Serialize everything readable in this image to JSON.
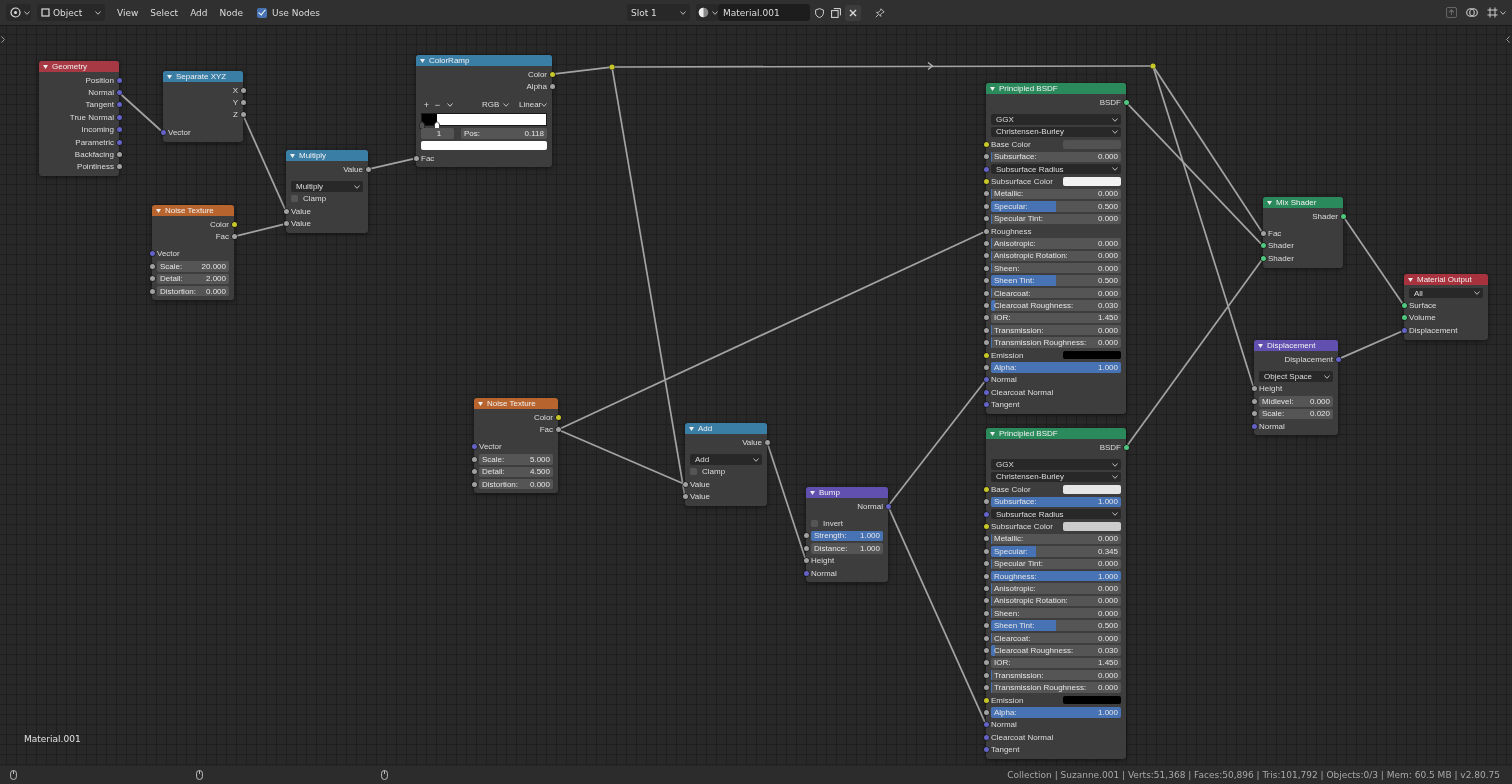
{
  "header": {
    "mode": "Object",
    "menus": [
      "View",
      "Select",
      "Add",
      "Node"
    ],
    "use_nodes": {
      "label": "Use Nodes",
      "checked": true
    },
    "slot": "Slot 1",
    "material": "Material.001"
  },
  "nodes": [
    {
      "title": "Geometry",
      "color": "#a63943",
      "rows": [
        {
          "kind": "output",
          "label": "Position",
          "socket": {
            "color": "#6363c7"
          }
        },
        {
          "kind": "output",
          "label": "Normal",
          "socket": {
            "color": "#6363c7"
          }
        },
        {
          "kind": "output",
          "label": "Tangent",
          "socket": {
            "color": "#6363c7"
          }
        },
        {
          "kind": "output",
          "label": "True Normal",
          "socket": {
            "color": "#6363c7"
          }
        },
        {
          "kind": "output",
          "label": "Incoming",
          "socket": {
            "color": "#6363c7"
          }
        },
        {
          "kind": "output",
          "label": "Parametric",
          "socket": {
            "color": "#6363c7"
          }
        },
        {
          "kind": "output",
          "label": "Backfacing",
          "socket": {
            "color": "#a1a1a1"
          }
        },
        {
          "kind": "output",
          "label": "Pointiness",
          "socket": {
            "color": "#a1a1a1"
          }
        }
      ]
    },
    {
      "title": "Separate XYZ",
      "color": "#3a7ea6",
      "rows": [
        {
          "kind": "output",
          "label": "X",
          "socket": {
            "color": "#a1a1a1"
          }
        },
        {
          "kind": "output",
          "label": "Y",
          "socket": {
            "color": "#a1a1a1"
          }
        },
        {
          "kind": "output",
          "label": "Z",
          "socket": {
            "color": "#a1a1a1"
          }
        },
        {
          "kind": "input",
          "label": "Vector",
          "socket": {
            "color": "#6363c7"
          }
        }
      ]
    },
    {
      "title": "Multiply",
      "color": "#3a7ea6",
      "rows": [
        {
          "kind": "output",
          "label": "Value",
          "socket": {
            "color": "#a1a1a1"
          }
        },
        {
          "kind": "dropdown",
          "value": "Multiply"
        },
        {
          "kind": "checkbox",
          "label": "Clamp",
          "checked": false
        },
        {
          "kind": "input",
          "label": "Value",
          "socket": {
            "color": "#a1a1a1"
          }
        },
        {
          "kind": "input",
          "label": "Value",
          "socket": {
            "color": "#a1a1a1"
          }
        }
      ]
    },
    {
      "title": "Noise Texture",
      "color": "#b8642e",
      "rows": [
        {
          "kind": "output",
          "label": "Color",
          "socket": {
            "color": "#c7c729"
          }
        },
        {
          "kind": "output",
          "label": "Fac",
          "socket": {
            "color": "#a1a1a1"
          }
        },
        {
          "kind": "input",
          "label": "Vector",
          "socket": {
            "color": "#6363c7"
          }
        },
        {
          "kind": "number",
          "label": "Scale:",
          "value": "20.000",
          "socket": {
            "color": "#a1a1a1"
          }
        },
        {
          "kind": "number",
          "label": "Detail:",
          "value": "2.000",
          "socket": {
            "color": "#a1a1a1"
          }
        },
        {
          "kind": "number",
          "label": "Distortion:",
          "value": "0.000",
          "socket": {
            "color": "#a1a1a1"
          }
        }
      ]
    },
    {
      "title": "ColorRamp",
      "color": "#3a7ea6",
      "rows": [
        {
          "kind": "output",
          "label": "Color",
          "socket": {
            "color": "#c7c729"
          }
        },
        {
          "kind": "output",
          "label": "Alpha",
          "socket": {
            "color": "#a1a1a1"
          }
        },
        {
          "kind": "ramp-tools",
          "add": "+",
          "remove": "−",
          "color_mode": "RGB",
          "interpolation": "Linear"
        },
        {
          "kind": "ramp-bar",
          "stops": [
            {
              "color": "#000000",
              "level": 0,
              "selected": false
            },
            {
              "color": "#ffffff",
              "level": 0.118,
              "selected": true
            }
          ]
        },
        {
          "kind": "ramp-stop",
          "index": "1",
          "label": "Pos:",
          "value": "0.118"
        },
        {
          "kind": "color-field",
          "color": "#ffffff"
        },
        {
          "kind": "input",
          "label": "Fac",
          "socket": {
            "color": "#a1a1a1"
          }
        }
      ]
    },
    {
      "title": "Noise Texture",
      "color": "#b8642e",
      "rows": [
        {
          "kind": "output",
          "label": "Color",
          "socket": {
            "color": "#c7c729"
          }
        },
        {
          "kind": "output",
          "label": "Fac",
          "socket": {
            "color": "#a1a1a1"
          }
        },
        {
          "kind": "input",
          "label": "Vector",
          "socket": {
            "color": "#6363c7"
          }
        },
        {
          "kind": "number",
          "label": "Scale:",
          "value": "5.000",
          "socket": {
            "color": "#a1a1a1"
          }
        },
        {
          "kind": "number",
          "label": "Detail:",
          "value": "4.500",
          "socket": {
            "color": "#a1a1a1"
          }
        },
        {
          "kind": "number",
          "label": "Distortion:",
          "value": "0.000",
          "socket": {
            "color": "#a1a1a1"
          }
        }
      ]
    },
    {
      "title": "Add",
      "color": "#3a7ea6",
      "rows": [
        {
          "kind": "output",
          "label": "Value",
          "socket": {
            "color": "#a1a1a1"
          }
        },
        {
          "kind": "dropdown",
          "value": "Add"
        },
        {
          "kind": "checkbox",
          "label": "Clamp",
          "checked": false
        },
        {
          "kind": "input",
          "label": "Value",
          "socket": {
            "color": "#a1a1a1"
          }
        },
        {
          "kind": "input",
          "label": "Value",
          "socket": {
            "color": "#a1a1a1"
          }
        }
      ]
    },
    {
      "title": "Bump",
      "color": "#6150b0",
      "rows": [
        {
          "kind": "output",
          "label": "Normal",
          "socket": {
            "color": "#6363c7"
          }
        },
        {
          "kind": "checkbox",
          "label": "Invert",
          "checked": false
        },
        {
          "kind": "slider",
          "label": "Strength:",
          "value": "1.000",
          "level": 1,
          "socket": {
            "color": "#a1a1a1"
          }
        },
        {
          "kind": "number",
          "label": "Distance:",
          "value": "1.000",
          "socket": {
            "color": "#a1a1a1"
          }
        },
        {
          "kind": "input",
          "label": "Height",
          "socket": {
            "color": "#a1a1a1"
          }
        },
        {
          "kind": "input",
          "label": "Normal",
          "socket": {
            "color": "#6363c7"
          }
        }
      ]
    },
    {
      "title": "Principled BSDF",
      "color": "#2b8a5c",
      "rows": [
        {
          "kind": "output",
          "label": "BSDF",
          "socket": {
            "color": "#4fc77e"
          }
        },
        {
          "kind": "dropdown",
          "value": "GGX"
        },
        {
          "kind": "dropdown",
          "value": "Christensen-Burley"
        },
        {
          "kind": "color",
          "label": "Base Color",
          "color": "#525252",
          "socket": {
            "color": "#c7c729"
          }
        },
        {
          "kind": "slider",
          "label": "Subsurface:",
          "value": "0.000",
          "level": 0,
          "socket": {
            "color": "#a1a1a1"
          }
        },
        {
          "kind": "dropdown",
          "value": "Subsurface Radius",
          "socket": {
            "color": "#6363c7"
          }
        },
        {
          "kind": "color",
          "label": "Subsurface Color",
          "color": "#f2f2f2",
          "socket": {
            "color": "#c7c729"
          }
        },
        {
          "kind": "slider",
          "label": "Metallic:",
          "value": "0.000",
          "level": 0,
          "socket": {
            "color": "#a1a1a1"
          }
        },
        {
          "kind": "slider",
          "label": "Specular:",
          "value": "0.500",
          "level": 0.5,
          "socket": {
            "color": "#a1a1a1"
          }
        },
        {
          "kind": "slider",
          "label": "Specular Tint:",
          "value": "0.000",
          "level": 0,
          "socket": {
            "color": "#a1a1a1"
          }
        },
        {
          "kind": "input",
          "label": "Roughness",
          "socket": {
            "color": "#a1a1a1"
          }
        },
        {
          "kind": "slider",
          "label": "Anisotropic:",
          "value": "0.000",
          "level": 0,
          "socket": {
            "color": "#a1a1a1"
          }
        },
        {
          "kind": "slider",
          "label": "Anisotropic Rotation:",
          "value": "0.000",
          "level": 0,
          "socket": {
            "color": "#a1a1a1"
          }
        },
        {
          "kind": "slider",
          "label": "Sheen:",
          "value": "0.000",
          "level": 0,
          "socket": {
            "color": "#a1a1a1"
          }
        },
        {
          "kind": "slider",
          "label": "Sheen Tint:",
          "value": "0.500",
          "level": 0.5,
          "socket": {
            "color": "#a1a1a1"
          }
        },
        {
          "kind": "slider",
          "label": "Clearcoat:",
          "value": "0.000",
          "level": 0,
          "socket": {
            "color": "#a1a1a1"
          }
        },
        {
          "kind": "slider",
          "label": "Clearcoat Roughness:",
          "value": "0.030",
          "level": 0.03,
          "socket": {
            "color": "#a1a1a1"
          }
        },
        {
          "kind": "number",
          "label": "IOR:",
          "value": "1.450",
          "socket": {
            "color": "#a1a1a1"
          }
        },
        {
          "kind": "slider",
          "label": "Transmission:",
          "value": "0.000",
          "level": 0,
          "socket": {
            "color": "#a1a1a1"
          }
        },
        {
          "kind": "slider",
          "label": "Transmission Roughness:",
          "value": "0.000",
          "level": 0,
          "socket": {
            "color": "#a1a1a1"
          }
        },
        {
          "kind": "color",
          "label": "Emission",
          "color": "#000000",
          "socket": {
            "color": "#c7c729"
          }
        },
        {
          "kind": "slider",
          "label": "Alpha:",
          "value": "1.000",
          "level": 1,
          "socket": {
            "color": "#a1a1a1"
          }
        },
        {
          "kind": "input",
          "label": "Normal",
          "socket": {
            "color": "#6363c7"
          }
        },
        {
          "kind": "input",
          "label": "Clearcoat Normal",
          "socket": {
            "color": "#6363c7"
          }
        },
        {
          "kind": "input",
          "label": "Tangent",
          "socket": {
            "color": "#6363c7"
          }
        }
      ]
    },
    {
      "title": "Principled BSDF",
      "color": "#2b8a5c",
      "rows": [
        {
          "kind": "output",
          "label": "BSDF",
          "socket": {
            "color": "#4fc77e"
          }
        },
        {
          "kind": "dropdown",
          "value": "GGX"
        },
        {
          "kind": "dropdown",
          "value": "Christensen-Burley"
        },
        {
          "kind": "color",
          "label": "Base Color",
          "color": "#e6e6e6",
          "socket": {
            "color": "#c7c729"
          }
        },
        {
          "kind": "slider",
          "label": "Subsurface:",
          "value": "1.000",
          "level": 1,
          "socket": {
            "color": "#a1a1a1"
          }
        },
        {
          "kind": "dropdown",
          "value": "Subsurface Radius",
          "socket": {
            "color": "#6363c7"
          }
        },
        {
          "kind": "color",
          "label": "Subsurface Color",
          "color": "#cccccc",
          "socket": {
            "color": "#c7c729"
          }
        },
        {
          "kind": "slider",
          "label": "Metallic:",
          "value": "0.000",
          "level": 0,
          "socket": {
            "color": "#a1a1a1"
          }
        },
        {
          "kind": "slider",
          "label": "Specular:",
          "value": "0.345",
          "level": 0.345,
          "socket": {
            "color": "#a1a1a1"
          }
        },
        {
          "kind": "slider",
          "label": "Specular Tint:",
          "value": "0.000",
          "level": 0,
          "socket": {
            "color": "#a1a1a1"
          }
        },
        {
          "kind": "slider",
          "label": "Roughness:",
          "value": "1.000",
          "level": 1,
          "socket": {
            "color": "#a1a1a1"
          }
        },
        {
          "kind": "slider",
          "label": "Anisotropic:",
          "value": "0.000",
          "level": 0,
          "socket": {
            "color": "#a1a1a1"
          }
        },
        {
          "kind": "slider",
          "label": "Anisotropic Rotation:",
          "value": "0.000",
          "level": 0,
          "socket": {
            "color": "#a1a1a1"
          }
        },
        {
          "kind": "slider",
          "label": "Sheen:",
          "value": "0.000",
          "level": 0,
          "socket": {
            "color": "#a1a1a1"
          }
        },
        {
          "kind": "slider",
          "label": "Sheen Tint:",
          "value": "0.500",
          "level": 0.5,
          "socket": {
            "color": "#a1a1a1"
          }
        },
        {
          "kind": "slider",
          "label": "Clearcoat:",
          "value": "0.000",
          "level": 0,
          "socket": {
            "color": "#a1a1a1"
          }
        },
        {
          "kind": "slider",
          "label": "Clearcoat Roughness:",
          "value": "0.030",
          "level": 0.03,
          "socket": {
            "color": "#a1a1a1"
          }
        },
        {
          "kind": "number",
          "label": "IOR:",
          "value": "1.450",
          "socket": {
            "color": "#a1a1a1"
          }
        },
        {
          "kind": "slider",
          "label": "Transmission:",
          "value": "0.000",
          "level": 0,
          "socket": {
            "color": "#a1a1a1"
          }
        },
        {
          "kind": "slider",
          "label": "Transmission Roughness:",
          "value": "0.000",
          "level": 0,
          "socket": {
            "color": "#a1a1a1"
          }
        },
        {
          "kind": "color",
          "label": "Emission",
          "color": "#000000",
          "socket": {
            "color": "#c7c729"
          }
        },
        {
          "kind": "slider",
          "label": "Alpha:",
          "value": "1.000",
          "level": 1,
          "socket": {
            "color": "#a1a1a1"
          }
        },
        {
          "kind": "input",
          "label": "Normal",
          "socket": {
            "color": "#6363c7"
          }
        },
        {
          "kind": "input",
          "label": "Clearcoat Normal",
          "socket": {
            "color": "#6363c7"
          }
        },
        {
          "kind": "input",
          "label": "Tangent",
          "socket": {
            "color": "#6363c7"
          }
        }
      ]
    },
    {
      "title": "Mix Shader",
      "color": "#2b8a5c",
      "rows": [
        {
          "kind": "output",
          "label": "Shader",
          "socket": {
            "color": "#4fc77e"
          }
        },
        {
          "kind": "input",
          "label": "Fac",
          "socket": {
            "color": "#a1a1a1"
          }
        },
        {
          "kind": "input",
          "label": "Shader",
          "socket": {
            "color": "#4fc77e"
          }
        },
        {
          "kind": "input",
          "label": "Shader",
          "socket": {
            "color": "#4fc77e"
          }
        }
      ]
    },
    {
      "title": "Displacement",
      "color": "#6150b0",
      "rows": [
        {
          "kind": "output",
          "label": "Displacement",
          "socket": {
            "color": "#6363c7"
          }
        },
        {
          "kind": "dropdown",
          "value": "Object Space"
        },
        {
          "kind": "input",
          "label": "Height",
          "socket": {
            "color": "#a1a1a1"
          }
        },
        {
          "kind": "number",
          "label": "Midlevel:",
          "value": "0.000",
          "socket": {
            "color": "#a1a1a1"
          }
        },
        {
          "kind": "number",
          "label": "Scale:",
          "value": "0.020",
          "socket": {
            "color": "#a1a1a1"
          }
        },
        {
          "kind": "input",
          "label": "Normal",
          "socket": {
            "color": "#6363c7"
          }
        }
      ]
    },
    {
      "title": "Material Output",
      "color": "#a8323d",
      "rows": [
        {
          "kind": "dropdown",
          "value": "All"
        },
        {
          "kind": "input",
          "label": "Surface",
          "socket": {
            "color": "#4fc77e"
          }
        },
        {
          "kind": "input",
          "label": "Volume",
          "socket": {
            "color": "#4fc77e"
          }
        },
        {
          "kind": "input",
          "label": "Displacement",
          "socket": {
            "color": "#6363c7"
          }
        }
      ]
    }
  ],
  "material_label": "Material.001",
  "status_bar": {
    "text": "Collection | Suzanne.001 | Verts:51,368 | Faces:50,896 | Tris:101,792 | Objects:0/3 | Mem: 60.5 MB | v2.80.75"
  }
}
